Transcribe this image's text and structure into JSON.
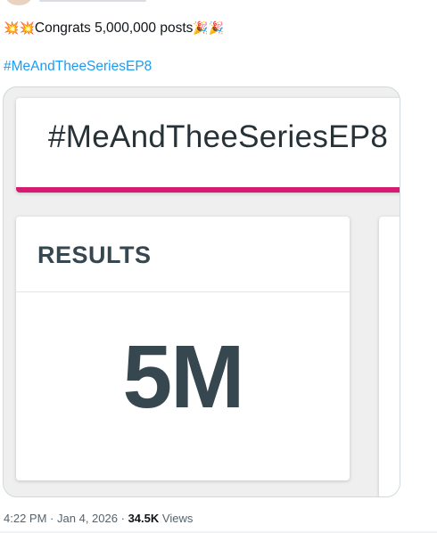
{
  "post": {
    "text": "Congrats 5,000,000 posts",
    "emoji_before": [
      "💥",
      "💥"
    ],
    "emoji_after": [
      "🎉",
      "🎉"
    ],
    "hashtag": "#MeAndTheeSeriesEP8"
  },
  "media": {
    "title": "#MeAndTheeSeriesEP8",
    "results_label": "RESULTS",
    "results_value": "5M",
    "accent_color": "#d81b72",
    "text_color": "#37474f"
  },
  "meta": {
    "time": "4:22 PM",
    "separator": "·",
    "date": "Jan 4, 2026",
    "views_count": "34.5K",
    "views_label": "Views"
  },
  "colors": {
    "link": "#1d9bf0",
    "muted": "#536471"
  }
}
